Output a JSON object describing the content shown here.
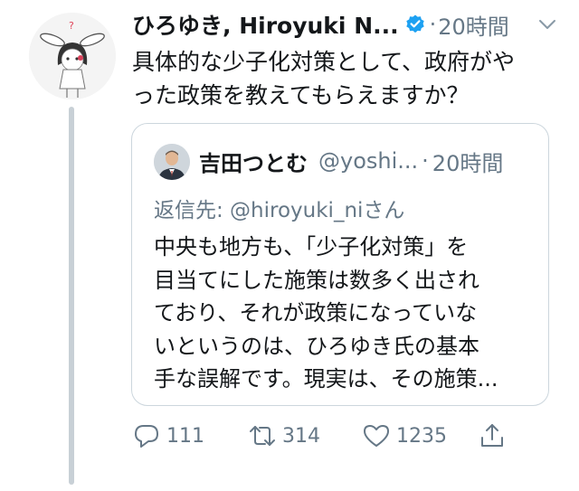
{
  "tweet": {
    "author_name": "ひろゆき, Hiroyuki N...",
    "separator": "·",
    "time": "20時間",
    "text_lines": [
      "具体的な少子化対策として、政府がや",
      "った政策を教えてもらえますか？"
    ]
  },
  "quote": {
    "author_name": "吉田つとむ",
    "handle": "@yoshi...",
    "separator": "·",
    "time": "20時間",
    "reply_to": "返信先: @hiroyuki_niさん",
    "text_lines": [
      "中央も地方も、「少子化対策」を",
      "目当てにした施策は数多く出され",
      "ており、それが政策になっていな",
      "いというのは、ひろゆき氏の基本",
      "手な誤解です。現実は、その施策..."
    ]
  },
  "actions": {
    "reply_count": "111",
    "retweet_count": "314",
    "like_count": "1235"
  },
  "colors": {
    "text": "#14171a",
    "secondary": "#657786",
    "verified": "#1da1f2",
    "border": "#ccd6dd",
    "thread_line": "#c8d0d6"
  },
  "icons": [
    "caret-down-icon",
    "verified-badge-icon",
    "reply-icon",
    "retweet-icon",
    "like-icon",
    "share-icon"
  ]
}
